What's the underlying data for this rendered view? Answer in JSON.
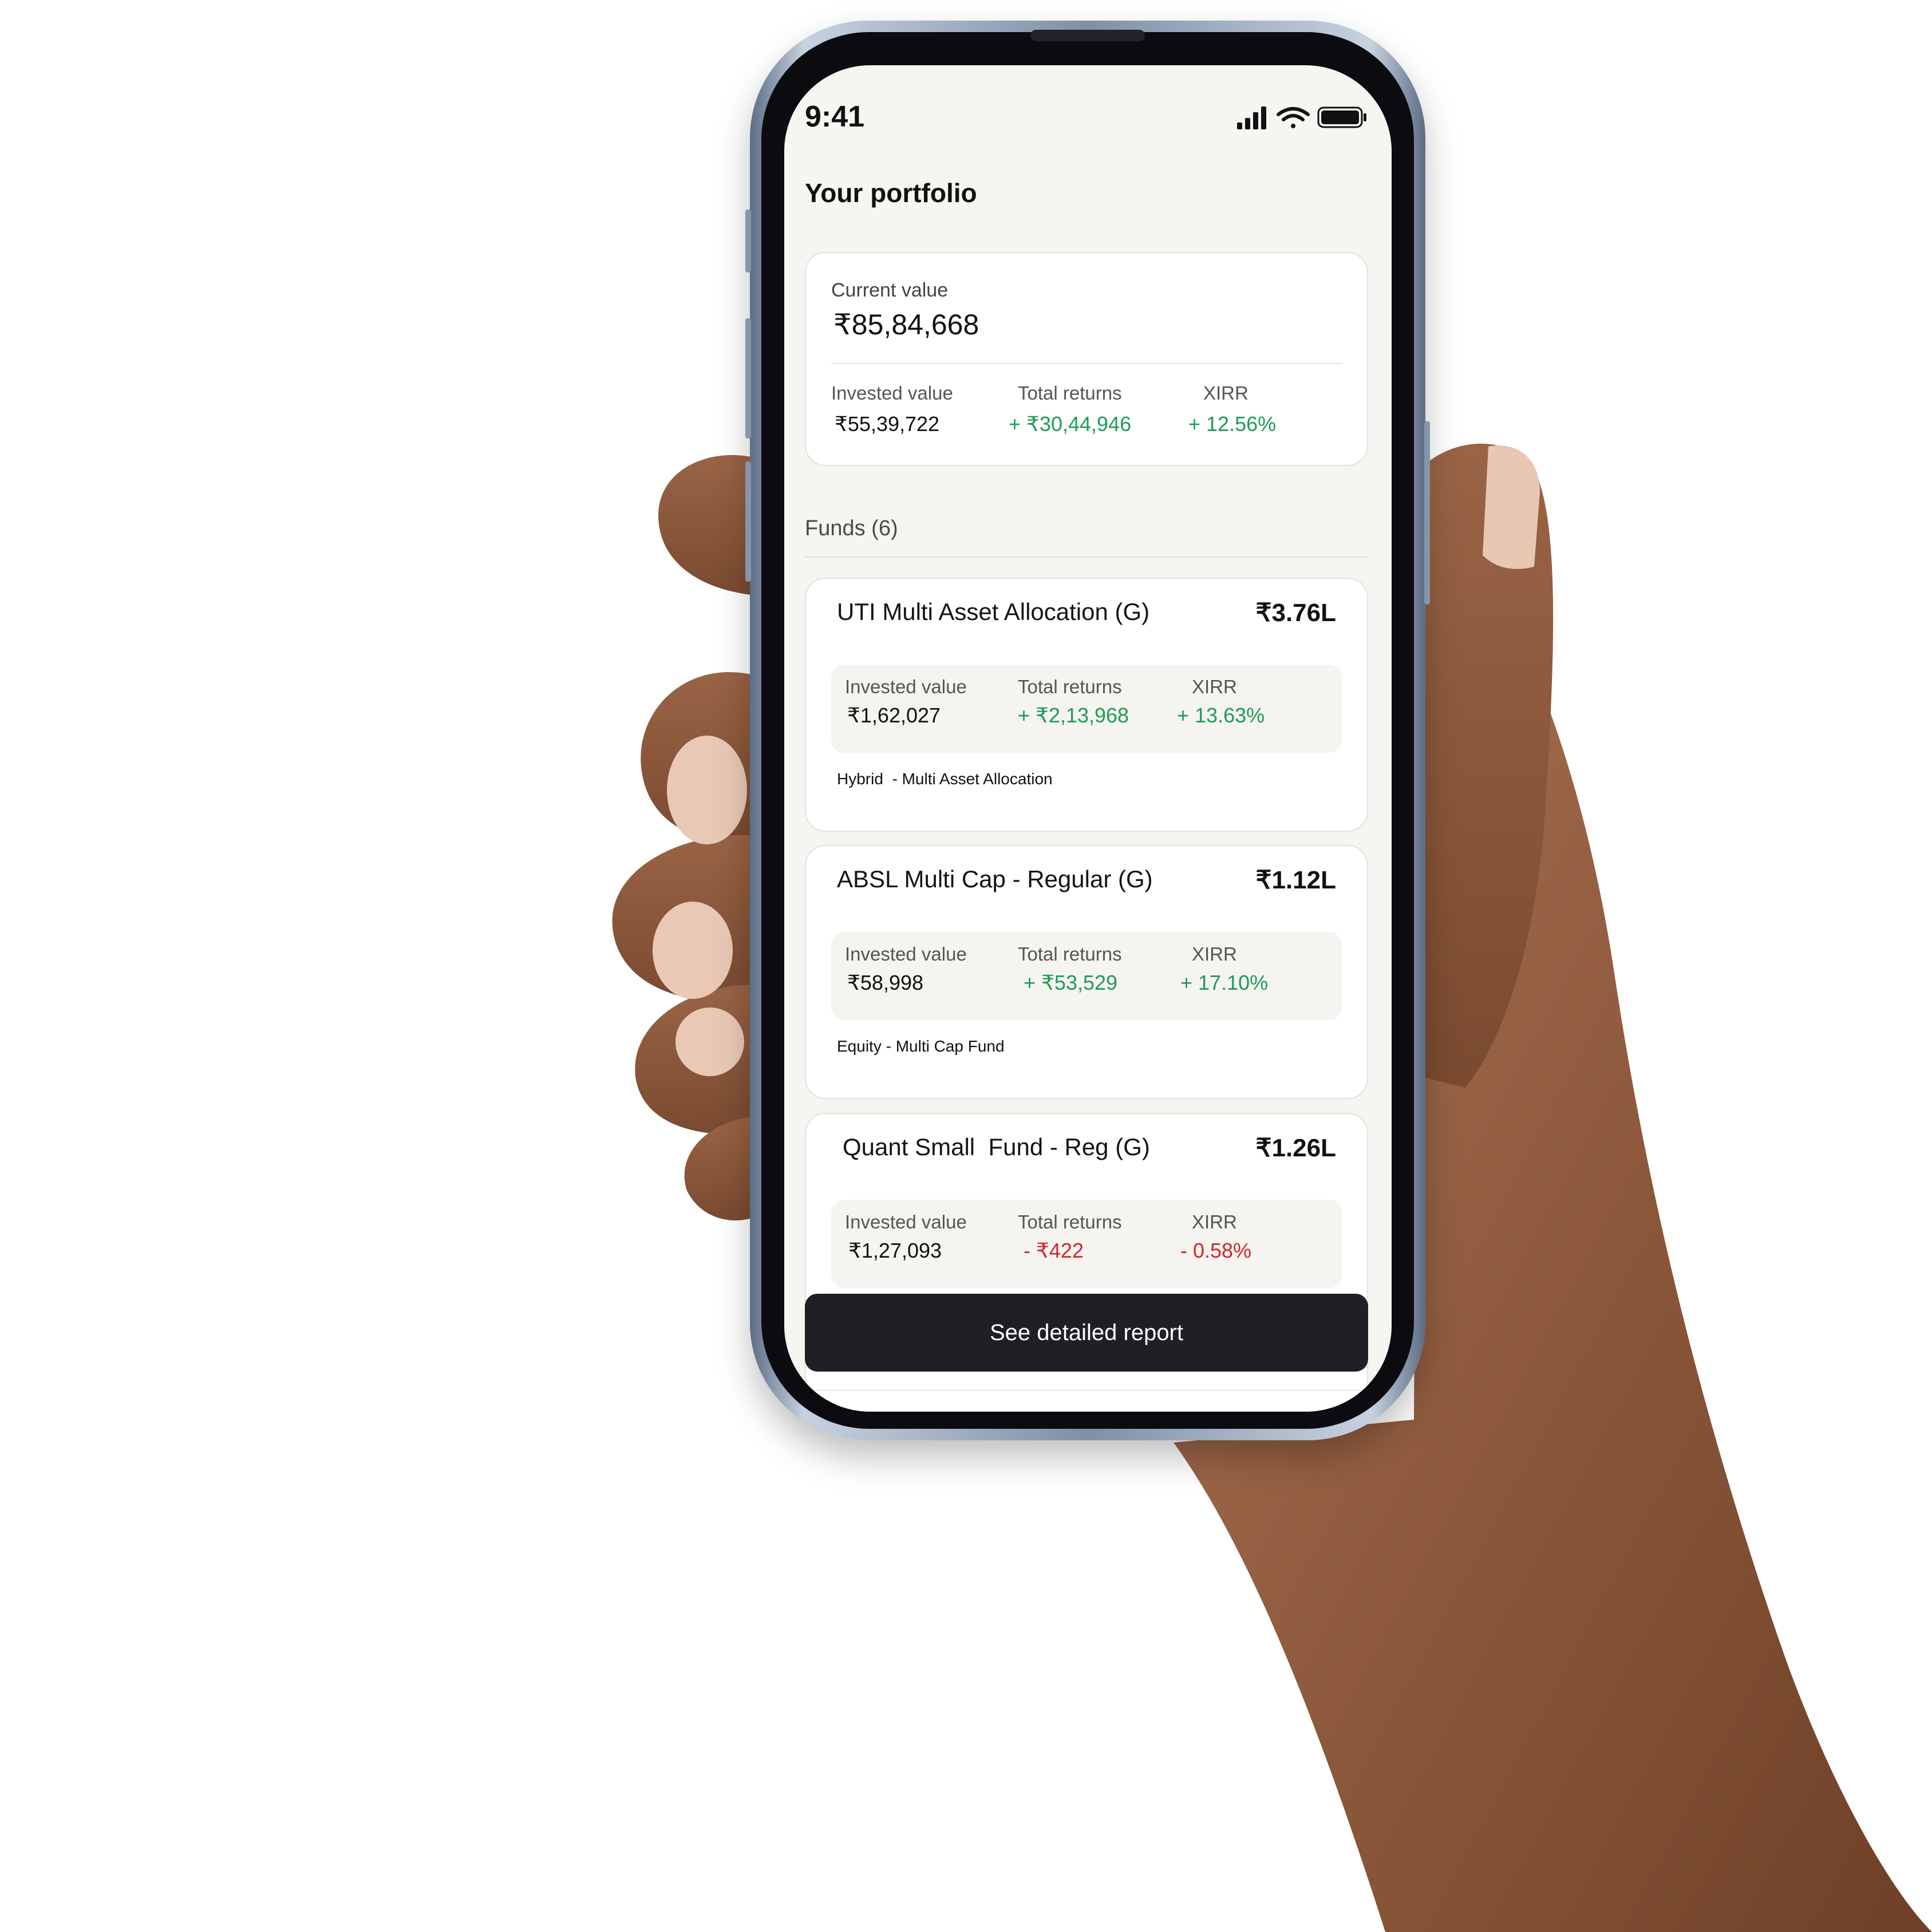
{
  "status_bar": {
    "time": "9:41",
    "icons": [
      "signal-icon",
      "wifi-icon",
      "battery-icon"
    ]
  },
  "page": {
    "title": "Your portfolio"
  },
  "summary": {
    "current_label": "Current value",
    "current_value": "₹85,84,668",
    "invested_label": "Invested value",
    "invested_value": "₹55,39,722",
    "returns_label": "Total returns",
    "returns_value": "+ ₹30,44,946",
    "xirr_label": "XIRR",
    "xirr_value": "+ 12.56%"
  },
  "funds": {
    "heading": "Funds (6)",
    "items": [
      {
        "name": "UTI Multi Asset Allocation (G)",
        "value": "₹3.76L",
        "invested_label": "Invested value",
        "invested": "₹1,62,027",
        "returns_label": "Total returns",
        "returns": "+ ₹2,13,968",
        "xirr_label": "XIRR",
        "xirr": "+ 13.63%",
        "category": "Hybrid  - Multi Asset Allocation"
      },
      {
        "name": "ABSL Multi Cap - Regular (G)",
        "value": "₹1.12L",
        "invested_label": "Invested value",
        "invested": "₹58,998",
        "returns_label": "Total returns",
        "returns": "+ ₹53,529",
        "xirr_label": "XIRR",
        "xirr": "+ 17.10%",
        "category": "Equity - Multi Cap Fund"
      },
      {
        "name": "Quant Small  Fund - Reg (G)",
        "value": "₹1.26L",
        "invested_label": "Invested value",
        "invested": "₹1,27,093",
        "returns_label": "Total returns",
        "returns": "- ₹422",
        "xirr_label": "XIRR",
        "xirr": "- 0.58%"
      }
    ]
  },
  "cta": {
    "label": "See detailed report"
  },
  "colors": {
    "positive": "#1e9b56",
    "negative": "#d3262b",
    "button_bg": "#1f2024",
    "screen_bg": "#f6f5f2"
  }
}
